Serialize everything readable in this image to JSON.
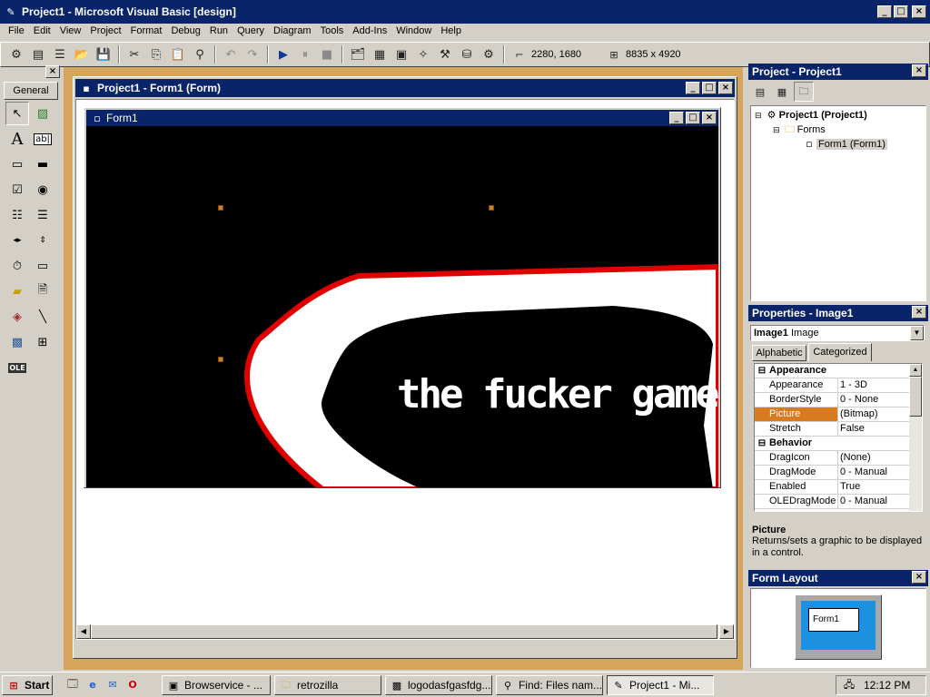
{
  "window": {
    "title": "Project1 - Microsoft Visual Basic [design]"
  },
  "menu": [
    "File",
    "Edit",
    "View",
    "Project",
    "Format",
    "Debug",
    "Run",
    "Query",
    "Diagram",
    "Tools",
    "Add-Ins",
    "Window",
    "Help"
  ],
  "toolbar": {
    "position": "2280, 1680",
    "size": "8835 x 4920"
  },
  "toolbox": {
    "tab_label": "General",
    "tools": [
      "pointer",
      "picture-box",
      "label",
      "textbox",
      "frame",
      "command-button",
      "checkbox",
      "option-button",
      "combobox",
      "listbox",
      "hscrollbar",
      "vscrollbar",
      "timer",
      "drive-list",
      "dir-list",
      "file-list",
      "shape",
      "line",
      "image",
      "data",
      "ole"
    ]
  },
  "form_designer": {
    "title": "Project1 - Form1 (Form)",
    "form_caption": "Form1",
    "image_text": "the fucker game"
  },
  "project_explorer": {
    "title": "Project - Project1",
    "root": "Project1 (Project1)",
    "folder": "Forms",
    "item": "Form1 (Form1)"
  },
  "properties": {
    "title": "Properties - Image1",
    "object_name": "Image1",
    "object_type": "Image",
    "tabs": [
      "Alphabetic",
      "Categorized"
    ],
    "categories": [
      {
        "name": "Appearance",
        "rows": [
          {
            "key": "Appearance",
            "value": "1 - 3D"
          },
          {
            "key": "BorderStyle",
            "value": "0 - None"
          },
          {
            "key": "Picture",
            "value": "(Bitmap)"
          },
          {
            "key": "Stretch",
            "value": "False"
          }
        ]
      },
      {
        "name": "Behavior",
        "rows": [
          {
            "key": "DragIcon",
            "value": "(None)"
          },
          {
            "key": "DragMode",
            "value": "0 - Manual"
          },
          {
            "key": "Enabled",
            "value": "True"
          },
          {
            "key": "OLEDragMode",
            "value": "0 - Manual"
          }
        ]
      }
    ],
    "desc_title": "Picture",
    "desc_text": "Returns/sets a graphic to be displayed in a control."
  },
  "form_layout": {
    "title": "Form Layout",
    "preview_caption": "Form1"
  },
  "taskbar": {
    "start": "Start",
    "buttons": [
      "Browservice - ...",
      "retrozilla",
      "logodasfgasfdg...",
      "Find: Files nam...",
      "Project1 - Mi..."
    ],
    "clock": "12:12 PM"
  },
  "colors": {
    "title_active": "#0a246a",
    "mdi_bg": "#d4a55a",
    "highlight": "#d87b1e"
  }
}
